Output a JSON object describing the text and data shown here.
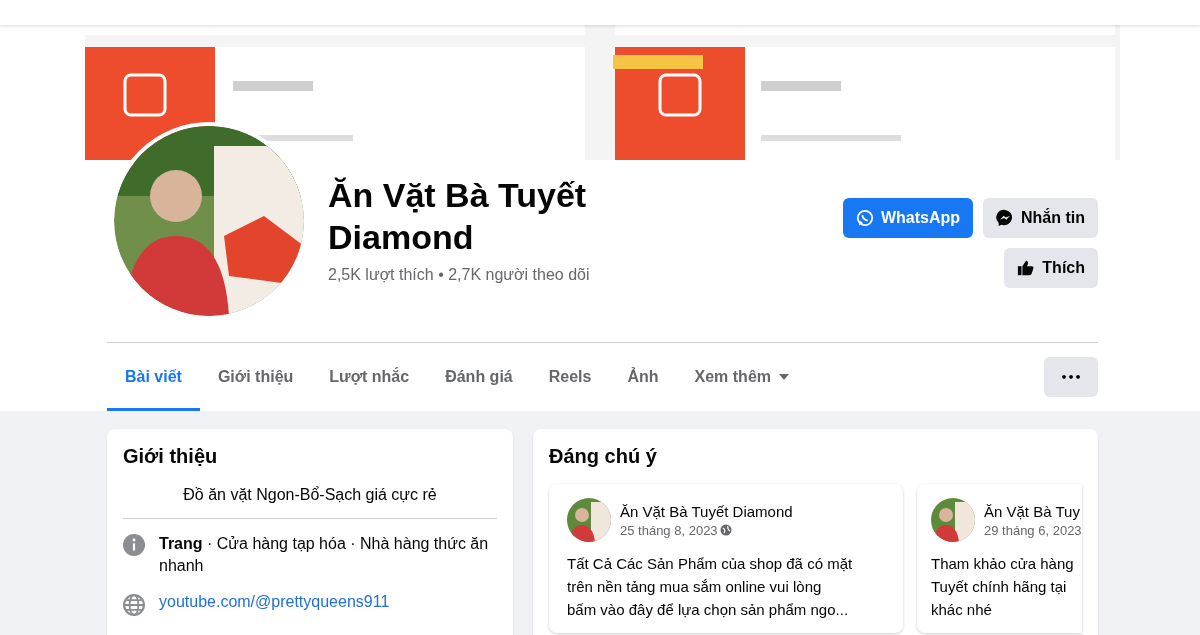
{
  "profile": {
    "name": "Ăn Vặt Bà Tuyết Diamond",
    "stats": "2,5K lượt thích • 2,7K người theo dõi"
  },
  "actions": [
    {
      "label": "WhatsApp",
      "kind": "whatsapp"
    },
    {
      "label": "Nhắn tin",
      "kind": "messenger"
    },
    {
      "label": "Thích",
      "kind": "like"
    }
  ],
  "tabs": [
    {
      "label": "Bài viết",
      "selected": true
    },
    {
      "label": "Giới thiệu",
      "selected": false
    },
    {
      "label": "Lượt nhắc",
      "selected": false
    },
    {
      "label": "Đánh giá",
      "selected": false
    },
    {
      "label": "Reels",
      "selected": false
    },
    {
      "label": "Ảnh",
      "selected": false
    },
    {
      "label": "Xem thêm",
      "selected": false,
      "dropdown": true
    }
  ],
  "more_button": "•••",
  "intro": {
    "title": "Giới thiệu",
    "bio": "Đồ ăn vặt Ngon-Bổ-Sạch giá cực rẻ",
    "items": [
      {
        "kind": "info",
        "text": "**Trang** · Cửa hàng tạp hóa · Nhà hàng thức ăn nhanh"
      },
      {
        "kind": "link",
        "text": "youtube.com/@prettyqueens911"
      }
    ]
  },
  "featured": {
    "title": "Đáng chú ý",
    "posts": [
      {
        "author": "Ăn Vặt Bà Tuyết Diamond",
        "date": "25 tháng 8, 2023",
        "lines": [
          "Tất Cả Các Sản Phẩm của shop đã có mặt",
          "trên nền tảng mua sắm online vui lòng",
          "bấm vào đây để lựa chọn sản phẩm ngo..."
        ]
      },
      {
        "author": "Ăn Vặt Bà Tuy",
        "date": "29 tháng 6, 2023",
        "lines": [
          "Tham khảo cửa hàng",
          "Tuyết chính hãng tại",
          "khác nhé"
        ]
      }
    ]
  }
}
